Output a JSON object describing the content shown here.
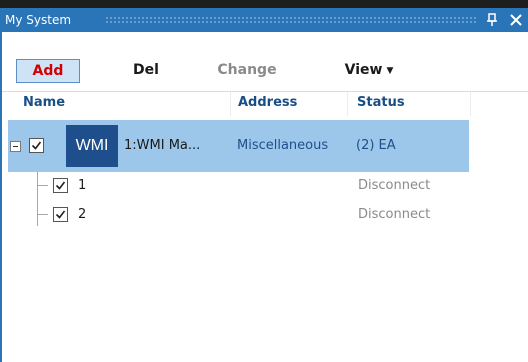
{
  "panel": {
    "title": "My System",
    "pin_icon": "pin-icon",
    "close_icon": "close-icon",
    "titlebar_color": "#2a74b8"
  },
  "toolbar": {
    "add_label": "Add",
    "del_label": "Del",
    "change_label": "Change",
    "view_label": "View",
    "add_color": "#d40000",
    "add_background": "#cfe3f6"
  },
  "columns": {
    "name": "Name",
    "address": "Address",
    "status": "Status"
  },
  "tree": {
    "parent": {
      "logo_text": "WMI",
      "name": "1:WMI Ma...",
      "address": "Miscellaneous",
      "status": "(2) EA",
      "checked": true,
      "expanded": true,
      "selected_color": "#9cc7eb"
    },
    "children": [
      {
        "label": "1",
        "status": "Disconnect",
        "checked": true
      },
      {
        "label": "2",
        "status": "Disconnect",
        "checked": true
      }
    ]
  }
}
